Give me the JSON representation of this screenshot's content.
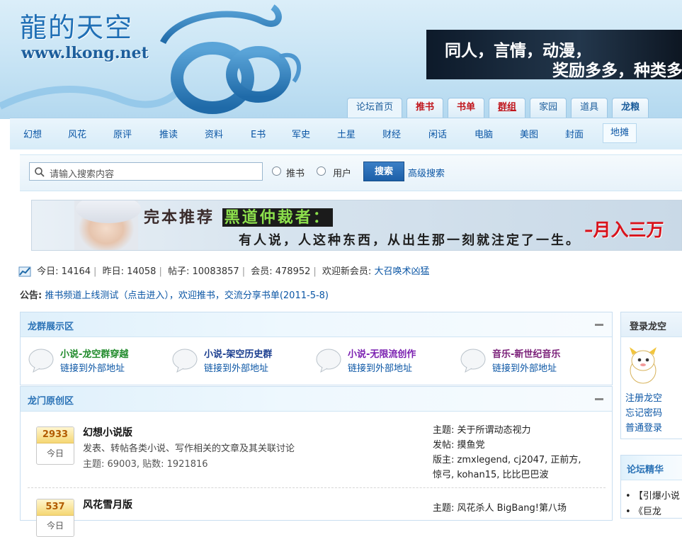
{
  "header": {
    "logo_cn": "龍的天空",
    "logo_url": "www.lkong.net",
    "banner_line1": "同人，言情，动漫，",
    "banner_line2": "奖励多多，种类多"
  },
  "top_tabs": [
    {
      "label": "论坛首页"
    },
    {
      "label": "推书"
    },
    {
      "label": "书单"
    },
    {
      "label": "群组"
    },
    {
      "label": "家园"
    },
    {
      "label": "道具"
    },
    {
      "label": "龙粮"
    }
  ],
  "subnav": [
    "幻想",
    "风花",
    "原评",
    "推读",
    "资料",
    "E书",
    "军史",
    "土星",
    "财经",
    "闲话",
    "电脑",
    "美图",
    "封面",
    "地摊"
  ],
  "search": {
    "placeholder": "请输入搜索内容",
    "radio_book": "推书",
    "radio_user": "用户",
    "button": "搜索",
    "advanced": "高级搜索"
  },
  "banner_ad": {
    "title_a": "完本推荐",
    "title_b": "黑道仲裁者：",
    "line2": "有人说，人这种东西，从出生那一刻就注定了一生。",
    "right": "–月入三万"
  },
  "stats": {
    "today_label": "今日:",
    "today": "14164",
    "yesterday_label": "昨日:",
    "yesterday": "14058",
    "posts_label": "帖子:",
    "posts": "10083857",
    "members_label": "会员:",
    "members": "478952",
    "welcome_label": "欢迎新会员:",
    "new_member": "大召唤术凶猛"
  },
  "announce": {
    "label": "公告:",
    "text": "推书频道上线测试（点击进入），欢迎推书，交流分享书单(2011-5-8)"
  },
  "groups_panel": {
    "title": "龙群展示区",
    "groups": [
      {
        "name": "小说-龙空群穿越",
        "link": "链接到外部地址",
        "color": "#1f8a2a"
      },
      {
        "name": "小说-架空历史群",
        "link": "链接到外部地址",
        "color": "#1a3d8f"
      },
      {
        "name": "小说-无限流创作",
        "link": "链接到外部地址",
        "color": "#7a1fb0"
      },
      {
        "name": "音乐-新世纪音乐",
        "link": "链接到外部地址",
        "color": "#7a1f78"
      }
    ]
  },
  "forums_panel": {
    "title": "龙门原创区",
    "forums": [
      {
        "today": "2933",
        "today_label": "今日",
        "name": "幻想小说版",
        "desc": "发表、转帖各类小说、写作相关的文章及其关联讨论",
        "count": "主题: 69003, 贴数: 1921816",
        "topic": "主题: 关于所谓动态视力",
        "poster": "发帖: 摸鱼党",
        "mods": "版主: zmxlegend, cj2047, 正前方,",
        "mods2": "惊弓, kohan15, 比比巴巴波"
      },
      {
        "today": "537",
        "today_label": "今日",
        "name": "风花雪月版",
        "topic": "主题: 风花杀人 BigBang!第八场"
      }
    ]
  },
  "login_panel": {
    "title": "登录龙空",
    "links": [
      "注册龙空",
      "忘记密码",
      "普通登录"
    ]
  },
  "essence_panel": {
    "title": "论坛精华",
    "items": [
      "【引爆小说",
      "《巨龙"
    ]
  }
}
